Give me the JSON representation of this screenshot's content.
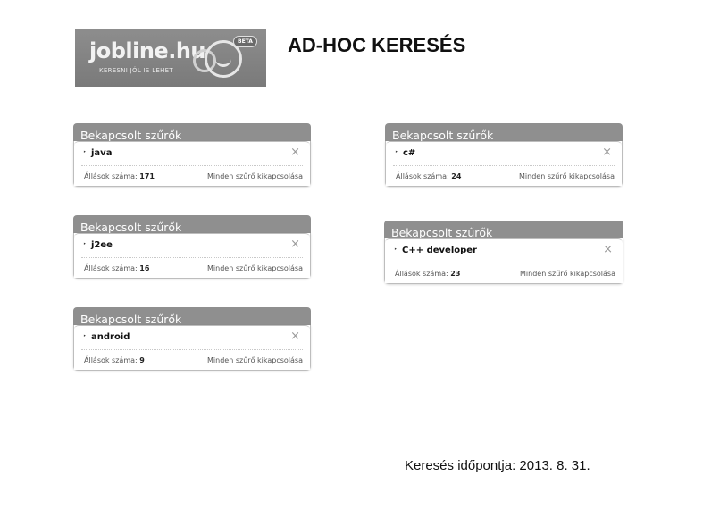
{
  "logo": {
    "name": "jobline.hu",
    "tagline": "KERESNI JÓL IS LEHET",
    "badge": "BETA"
  },
  "title": "AD-HOC KERESÉS",
  "panel_header": "Bekapcsolt szűrők",
  "count_prefix": "Állások száma:",
  "disable_all_label": "Minden szűrő kikapcsolása",
  "close_glyph": "×",
  "bullet_glyph": "‣",
  "panels": [
    {
      "header": "Bekapcsolt szűrők",
      "term": "java",
      "count_prefix": "Állások száma:",
      "count": "171",
      "disable_all": "Minden szűrő kikapcsolása"
    },
    {
      "header": "Bekapcsolt szűrők",
      "term": "j2ee",
      "count_prefix": "Állások száma:",
      "count": "16",
      "disable_all": "Minden szűrő kikapcsolása"
    },
    {
      "header": "Bekapcsolt szűrők",
      "term": "android",
      "count_prefix": "Állások száma:",
      "count": "9",
      "disable_all": "Minden szűrő kikapcsolása"
    },
    {
      "header": "Bekapcsolt szűrők",
      "term": "c#",
      "count_prefix": "Állások száma:",
      "count": "24",
      "disable_all": "Minden szűrő kikapcsolása"
    },
    {
      "header": "Bekapcsolt szűrők",
      "term": "C++ developer",
      "count_prefix": "Állások száma:",
      "count": "23",
      "disable_all": "Minden szűrő kikapcsolása"
    }
  ],
  "timestamp": "Keresés időpontja: 2013. 8. 31."
}
